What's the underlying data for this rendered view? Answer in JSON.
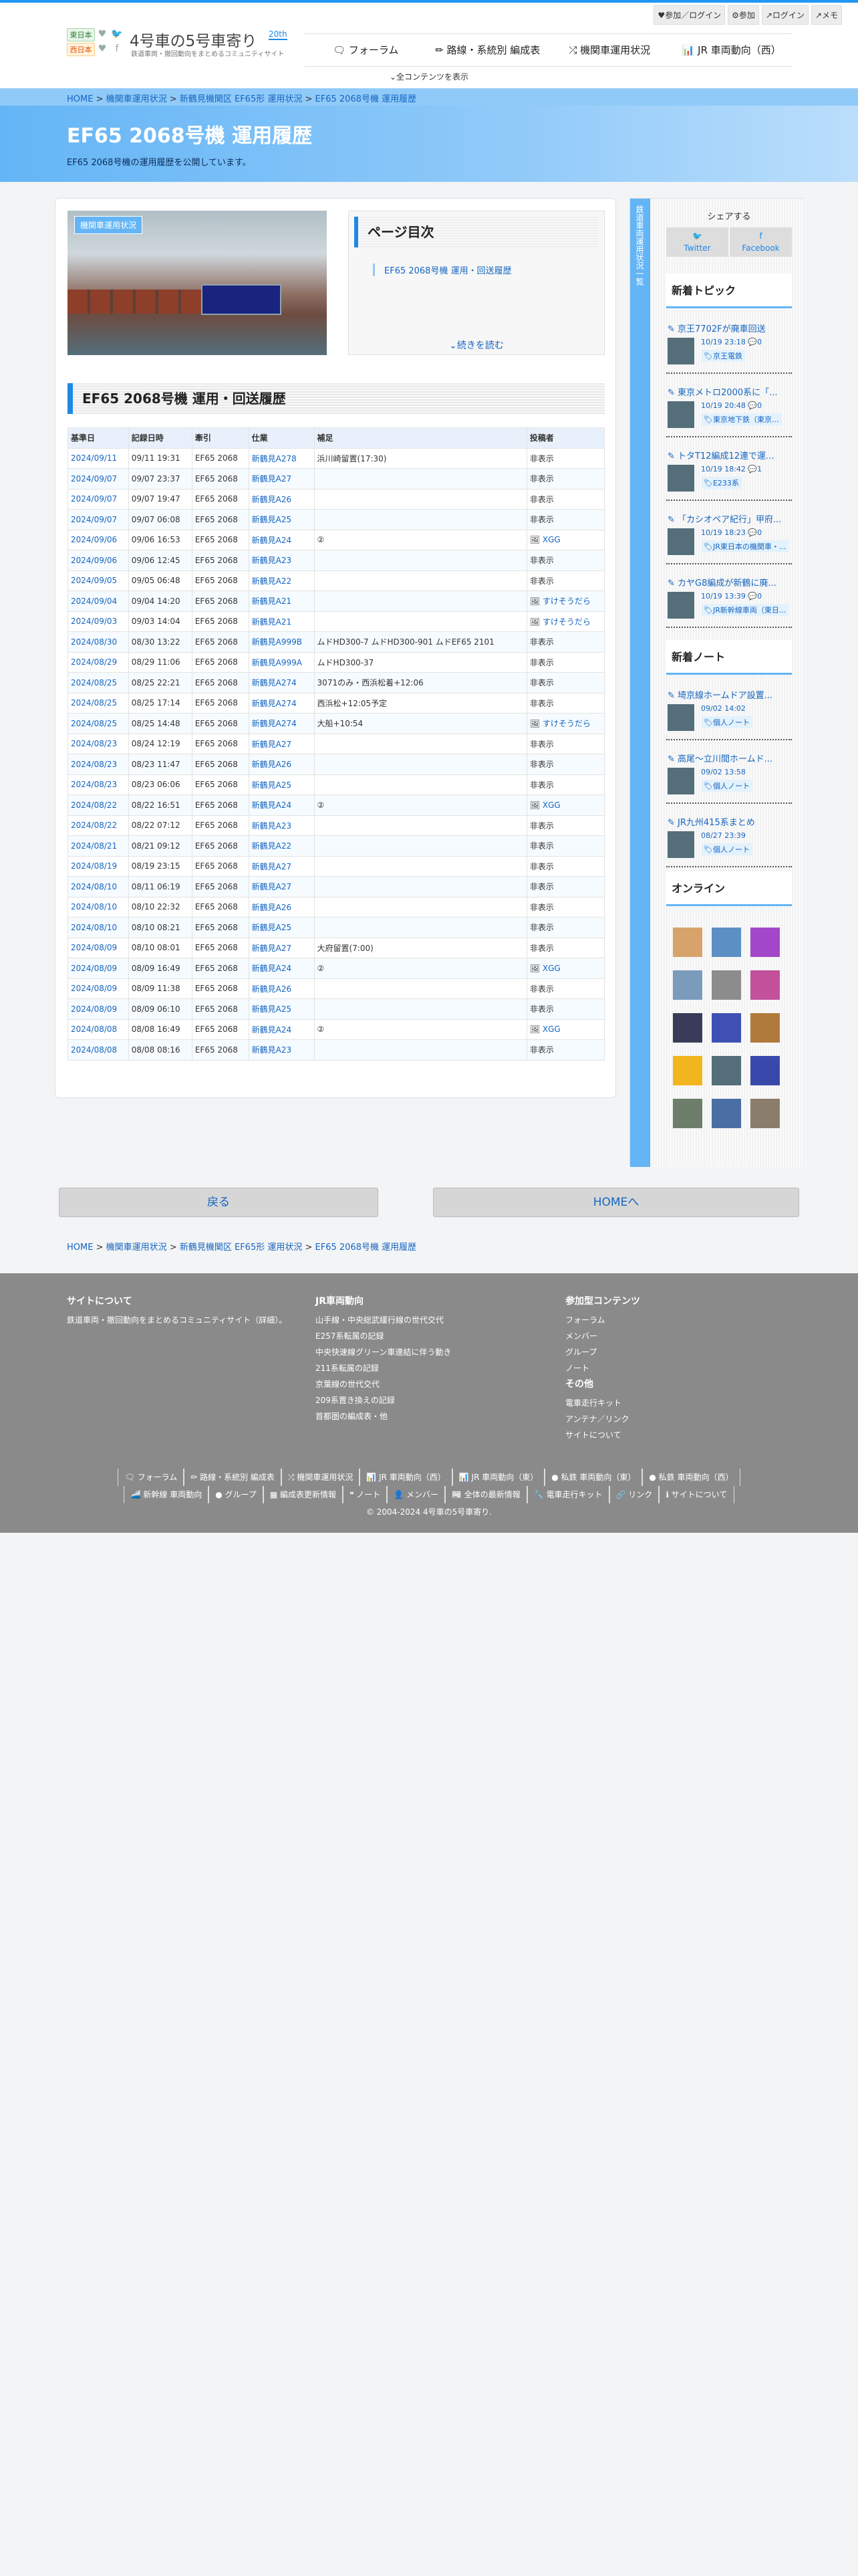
{
  "header": {
    "tag_east": "東日本",
    "tag_west": "西日本",
    "site_title": "4号車の5号車寄り",
    "site_badge": "20th",
    "site_sub": "鉄道車両・撤回動向をまとめるコミュニティサイト",
    "user_links": [
      "♥参加／ログイン",
      "⚙参加",
      "↗ログイン",
      "↗メモ"
    ],
    "nav": [
      "🗨 フォーラム",
      "✏ 路線・系統別 編成表",
      "⤮ 機関車運用状況",
      "📊 JR 車両動向（西）"
    ],
    "show_all": "全コンテンツを表示"
  },
  "breadcrumb": {
    "home": "HOME",
    "l1": "機関車運用状況",
    "l2": "新鶴見機関区 EF65形 運用状況",
    "l3": "EF65 2068号機 運用履歴",
    "sep": ">"
  },
  "hero": {
    "title": "EF65 2068号機 運用履歴",
    "desc": "EF65 2068号機の運用履歴を公開しています。"
  },
  "photo_label": "機関車運用状況",
  "toc": {
    "title": "ページ目次",
    "item": "EF65 2068号機 運用・回送履歴",
    "more": "続きを読む"
  },
  "section_title": "EF65 2068号機 運用・回送履歴",
  "table": {
    "headers": [
      "基準日",
      "記録日時",
      "牽引",
      "仕業",
      "補足",
      "投稿者"
    ],
    "rows": [
      [
        "2024/09/11",
        "09/11 19:31",
        "EF65 2068",
        "新鶴見A278",
        "浜川崎留置(17:30)",
        "非表示"
      ],
      [
        "2024/09/07",
        "09/07 23:37",
        "EF65 2068",
        "新鶴見A27",
        "",
        "非表示"
      ],
      [
        "2024/09/07",
        "09/07 19:47",
        "EF65 2068",
        "新鶴見A26",
        "",
        "非表示"
      ],
      [
        "2024/09/07",
        "09/07 06:08",
        "EF65 2068",
        "新鶴見A25",
        "",
        "非表示"
      ],
      [
        "2024/09/06",
        "09/06 16:53",
        "EF65 2068",
        "新鶴見A24",
        "②",
        "XGG"
      ],
      [
        "2024/09/06",
        "09/06 12:45",
        "EF65 2068",
        "新鶴見A23",
        "",
        "非表示"
      ],
      [
        "2024/09/05",
        "09/05 06:48",
        "EF65 2068",
        "新鶴見A22",
        "",
        "非表示"
      ],
      [
        "2024/09/04",
        "09/04 14:20",
        "EF65 2068",
        "新鶴見A21",
        "",
        "すけそうだら"
      ],
      [
        "2024/09/03",
        "09/03 14:04",
        "EF65 2068",
        "新鶴見A21",
        "",
        "すけそうだら"
      ],
      [
        "2024/08/30",
        "08/30 13:22",
        "EF65 2068",
        "新鶴見A999B",
        "ムドHD300-7 ムドHD300-901 ムドEF65 2101",
        "非表示"
      ],
      [
        "2024/08/29",
        "08/29 11:06",
        "EF65 2068",
        "新鶴見A999A",
        "ムドHD300-37",
        "非表示"
      ],
      [
        "2024/08/25",
        "08/25 22:21",
        "EF65 2068",
        "新鶴見A274",
        "3071のみ・西浜松着+12:06",
        "非表示"
      ],
      [
        "2024/08/25",
        "08/25 17:14",
        "EF65 2068",
        "新鶴見A274",
        "西浜松+12:05予定",
        "非表示"
      ],
      [
        "2024/08/25",
        "08/25 14:48",
        "EF65 2068",
        "新鶴見A274",
        "大船+10:54",
        "すけそうだら"
      ],
      [
        "2024/08/23",
        "08/24 12:19",
        "EF65 2068",
        "新鶴見A27",
        "",
        "非表示"
      ],
      [
        "2024/08/23",
        "08/23 11:47",
        "EF65 2068",
        "新鶴見A26",
        "",
        "非表示"
      ],
      [
        "2024/08/23",
        "08/23 06:06",
        "EF65 2068",
        "新鶴見A25",
        "",
        "非表示"
      ],
      [
        "2024/08/22",
        "08/22 16:51",
        "EF65 2068",
        "新鶴見A24",
        "②",
        "XGG"
      ],
      [
        "2024/08/22",
        "08/22 07:12",
        "EF65 2068",
        "新鶴見A23",
        "",
        "非表示"
      ],
      [
        "2024/08/21",
        "08/21 09:12",
        "EF65 2068",
        "新鶴見A22",
        "",
        "非表示"
      ],
      [
        "2024/08/19",
        "08/19 23:15",
        "EF65 2068",
        "新鶴見A27",
        "",
        "非表示"
      ],
      [
        "2024/08/10",
        "08/11 06:19",
        "EF65 2068",
        "新鶴見A27",
        "",
        "非表示"
      ],
      [
        "2024/08/10",
        "08/10 22:32",
        "EF65 2068",
        "新鶴見A26",
        "",
        "非表示"
      ],
      [
        "2024/08/10",
        "08/10 08:21",
        "EF65 2068",
        "新鶴見A25",
        "",
        "非表示"
      ],
      [
        "2024/08/09",
        "08/10 08:01",
        "EF65 2068",
        "新鶴見A27",
        "大府留置(7:00)",
        "非表示"
      ],
      [
        "2024/08/09",
        "08/09 16:49",
        "EF65 2068",
        "新鶴見A24",
        "②",
        "XGG"
      ],
      [
        "2024/08/09",
        "08/09 11:38",
        "EF65 2068",
        "新鶴見A26",
        "",
        "非表示"
      ],
      [
        "2024/08/09",
        "08/09 06:10",
        "EF65 2068",
        "新鶴見A25",
        "",
        "非表示"
      ],
      [
        "2024/08/08",
        "08/08 16:49",
        "EF65 2068",
        "新鶴見A24",
        "②",
        "XGG"
      ],
      [
        "2024/08/08",
        "08/08 08:16",
        "EF65 2068",
        "新鶴見A23",
        "",
        "非表示"
      ]
    ]
  },
  "sidebar": {
    "vertical": "鉄道車両運用状況一覧",
    "share": "シェアする",
    "twitter": "Twitter",
    "facebook": "Facebook",
    "topics_title": "新着トピック",
    "topics": [
      {
        "t": "京王7702Fが廃車回送",
        "d": "10/19 23:18 💬0",
        "c": "京王電鉄"
      },
      {
        "t": "東京メトロ2000系に「...",
        "d": "10/19 20:48 💬0",
        "c": "東京地下鉄（東京..."
      },
      {
        "t": "トタT12編成12連で運...",
        "d": "10/19 18:42 💬1",
        "c": "E233系"
      },
      {
        "t": "「カシオペア紀行」甲府...",
        "d": "10/19 18:23 💬0",
        "c": "JR東日本の機関車・..."
      },
      {
        "t": "カヤG8編成が新鶴に廃...",
        "d": "10/19 13:39 💬0",
        "c": "JR新幹線車両（東日..."
      }
    ],
    "notes_title": "新着ノート",
    "notes": [
      {
        "t": "埼京線ホームドア設置...",
        "d": "09/02 14:02",
        "c": "個人ノート"
      },
      {
        "t": "高尾〜立川間ホームド...",
        "d": "09/02 13:58",
        "c": "個人ノート"
      },
      {
        "t": "JR九州415系まとめ",
        "d": "08/27 23:39",
        "c": "個人ノート"
      }
    ],
    "online_title": "オンライン"
  },
  "buttons": {
    "back": "戻る",
    "home": "HOMEへ"
  },
  "footer": {
    "c1_title": "サイトについて",
    "c1_text": "鉄道車両・撤回動向をまとめるコミュニティサイト（詳細）。",
    "c2_title": "JR車両動向",
    "c2_items": [
      "山手線・中央総武緩行線の世代交代",
      "E257系転属の記録",
      "中央快速線グリーン車連結に伴う動き",
      "211系転属の記録",
      "京葉線の世代交代",
      "209系置き換えの記録",
      "首都圏の編成表・他"
    ],
    "c3_title": "参加型コンテンツ",
    "c3_items": [
      "フォーラム",
      "メンバー",
      "グループ",
      "ノート"
    ],
    "c4_title": "その他",
    "c4_items": [
      "電車走行キット",
      "アンテナ／リンク",
      "サイトについて"
    ],
    "links1": [
      "🗨 フォーラム",
      "✏ 路線・系統別 編成表",
      "⤮ 機関車運用状況",
      "📊 JR 車両動向（西）",
      "📊 JR 車両動向（東）",
      "● 私鉄 車両動向（東）",
      "● 私鉄 車両動向（西）"
    ],
    "links2": [
      "🚄 新幹線 車両動向",
      "● グループ",
      "▦ 編成表更新情報",
      "❝ ノート",
      "👤 メンバー",
      "📰 全体の最新情報",
      "🔧 電車走行キット",
      "🔗 リンク",
      "ℹ サイトについて"
    ],
    "copyright": "© 2004-2024 4号車の5号車寄り."
  }
}
